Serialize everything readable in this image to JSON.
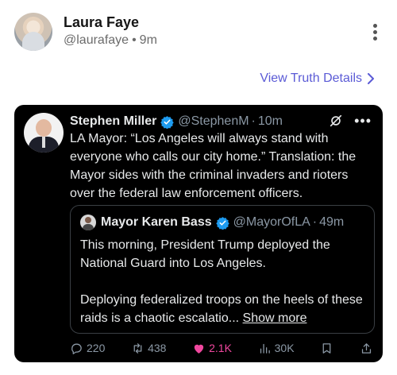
{
  "post": {
    "author_name": "Laura Faye",
    "author_handle": "@laurafaye",
    "separator": "•",
    "time": "9m"
  },
  "truth_link": {
    "label": "View Truth Details"
  },
  "tweet": {
    "author_name": "Stephen Miller",
    "author_handle": "@StephenM",
    "separator": "·",
    "time": "10m",
    "more_label": "•••",
    "text": "LA Mayor: “Los Angeles will always stand with everyone who calls our city home.” Translation: the Mayor sides with the criminal invaders and rioters over the federal law enforcement officers.",
    "quote": {
      "author_name": "Mayor Karen Bass",
      "author_handle": "@MayorOfLA",
      "separator": "·",
      "time": "49m",
      "paragraph1": "This morning, President Trump deployed the National Guard into Los Angeles.",
      "paragraph2": "Deploying federalized troops on the heels of these raids is a chaotic escalatio...",
      "show_more": "Show more"
    },
    "actions": {
      "replies": "220",
      "reposts": "438",
      "likes": "2.1K",
      "views": "30K"
    }
  },
  "colors": {
    "link": "#5b5bd6",
    "verified": "#1d9bf0",
    "like": "#f0479e",
    "muted": "#8b98a5"
  }
}
